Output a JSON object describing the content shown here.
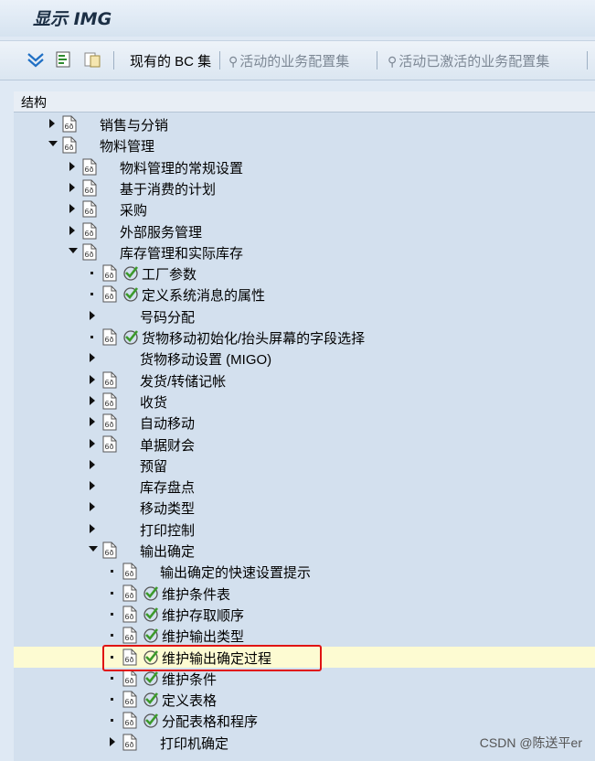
{
  "window": {
    "title": "显示 IMG"
  },
  "toolbar": {
    "current_bc_set": "现有的 BC 集",
    "active_bc_sets": "活动的业务配置集",
    "activated_bc_sets": "活动已激活的业务配置集",
    "icons": [
      "expand-icon",
      "execute-icon",
      "where-used-icon"
    ]
  },
  "panel": {
    "header": "结构"
  },
  "tree": [
    {
      "label": "销售与分销",
      "level": 0,
      "arrow": "right",
      "doc": true,
      "check": false
    },
    {
      "label": "物料管理",
      "level": 0,
      "arrow": "down",
      "doc": true,
      "check": false
    },
    {
      "label": "物料管理的常规设置",
      "level": 1,
      "arrow": "right",
      "doc": true,
      "check": false
    },
    {
      "label": "基于消费的计划",
      "level": 1,
      "arrow": "right",
      "doc": true,
      "check": false
    },
    {
      "label": "采购",
      "level": 1,
      "arrow": "right",
      "doc": true,
      "check": false
    },
    {
      "label": "外部服务管理",
      "level": 1,
      "arrow": "right",
      "doc": true,
      "check": false
    },
    {
      "label": "库存管理和实际库存",
      "level": 1,
      "arrow": "down",
      "doc": true,
      "check": false
    },
    {
      "label": "工厂参数",
      "level": 2,
      "arrow": "bullet",
      "doc": true,
      "check": true
    },
    {
      "label": "定义系统消息的属性",
      "level": 2,
      "arrow": "bullet",
      "doc": true,
      "check": true
    },
    {
      "label": "号码分配",
      "level": 2,
      "arrow": "right",
      "doc": false,
      "check": false
    },
    {
      "label": "货物移动初始化/抬头屏幕的字段选择",
      "level": 2,
      "arrow": "bullet",
      "doc": true,
      "check": true
    },
    {
      "label": "货物移动设置 (MIGO)",
      "level": 2,
      "arrow": "right",
      "doc": false,
      "check": false
    },
    {
      "label": "发货/转储记帐",
      "level": 2,
      "arrow": "right",
      "doc": true,
      "check": false
    },
    {
      "label": "收货",
      "level": 2,
      "arrow": "right",
      "doc": true,
      "check": false
    },
    {
      "label": "自动移动",
      "level": 2,
      "arrow": "right",
      "doc": true,
      "check": false
    },
    {
      "label": "单据财会",
      "level": 2,
      "arrow": "right",
      "doc": true,
      "check": false
    },
    {
      "label": "预留",
      "level": 2,
      "arrow": "right",
      "doc": false,
      "check": false
    },
    {
      "label": "库存盘点",
      "level": 2,
      "arrow": "right",
      "doc": false,
      "check": false
    },
    {
      "label": "移动类型",
      "level": 2,
      "arrow": "right",
      "doc": false,
      "check": false
    },
    {
      "label": "打印控制",
      "level": 2,
      "arrow": "right",
      "doc": false,
      "check": false
    },
    {
      "label": "输出确定",
      "level": 2,
      "arrow": "down",
      "doc": true,
      "check": false
    },
    {
      "label": "输出确定的快速设置提示",
      "level": 3,
      "arrow": "bullet",
      "doc": true,
      "check": false
    },
    {
      "label": "维护条件表",
      "level": 3,
      "arrow": "bullet",
      "doc": true,
      "check": true
    },
    {
      "label": "维护存取顺序",
      "level": 3,
      "arrow": "bullet",
      "doc": true,
      "check": true
    },
    {
      "label": "维护输出类型",
      "level": 3,
      "arrow": "bullet",
      "doc": true,
      "check": true
    },
    {
      "label": "维护输出确定过程",
      "level": 3,
      "arrow": "bullet",
      "doc": true,
      "check": true,
      "selected": true
    },
    {
      "label": "维护条件",
      "level": 3,
      "arrow": "bullet",
      "doc": true,
      "check": true
    },
    {
      "label": "定义表格",
      "level": 3,
      "arrow": "bullet",
      "doc": true,
      "check": true
    },
    {
      "label": "分配表格和程序",
      "level": 3,
      "arrow": "bullet",
      "doc": true,
      "check": true
    },
    {
      "label": "打印机确定",
      "level": 3,
      "arrow": "right",
      "doc": true,
      "check": false
    }
  ],
  "watermark": "CSDN @陈送平er",
  "colors": {
    "selected_row": "#fdfbd2",
    "highlight_box": "#e01313",
    "check_green": "#3c9a2b",
    "panel_bg": "#d3e0ee"
  }
}
